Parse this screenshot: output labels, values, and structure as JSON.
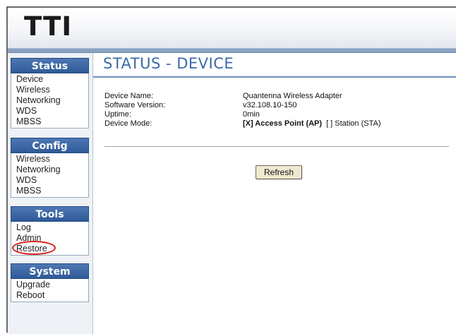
{
  "header": {
    "logo": "TTI"
  },
  "sidebar": {
    "sections": [
      {
        "title": "Status",
        "items": [
          "Device",
          "Wireless",
          "Networking",
          "WDS",
          "MBSS"
        ]
      },
      {
        "title": "Config",
        "items": [
          "Wireless",
          "Networking",
          "WDS",
          "MBSS"
        ]
      },
      {
        "title": "Tools",
        "items": [
          "Log",
          "Admin",
          "Restore"
        ]
      },
      {
        "title": "System",
        "items": [
          "Upgrade",
          "Reboot"
        ]
      }
    ]
  },
  "main": {
    "title": "STATUS - DEVICE",
    "info": [
      {
        "label": "Device Name:",
        "value": "Quantenna Wireless Adapter"
      },
      {
        "label": "Software Version:",
        "value": "v32.108.10-150"
      },
      {
        "label": "Uptime:",
        "value": "0min"
      },
      {
        "label": "Device Mode:"
      }
    ],
    "device_mode": {
      "selected": "[X] Access Point (AP)",
      "other": "[ ] Station (STA)"
    },
    "refresh_label": "Refresh"
  },
  "annotation": {
    "highlighted_item": "Restore",
    "color": "#d4201c"
  },
  "colors": {
    "nav_header": "#2f5a98",
    "title": "#3c6aa8",
    "header_bar": "#8aa3c2",
    "button": "#efe9cf"
  }
}
